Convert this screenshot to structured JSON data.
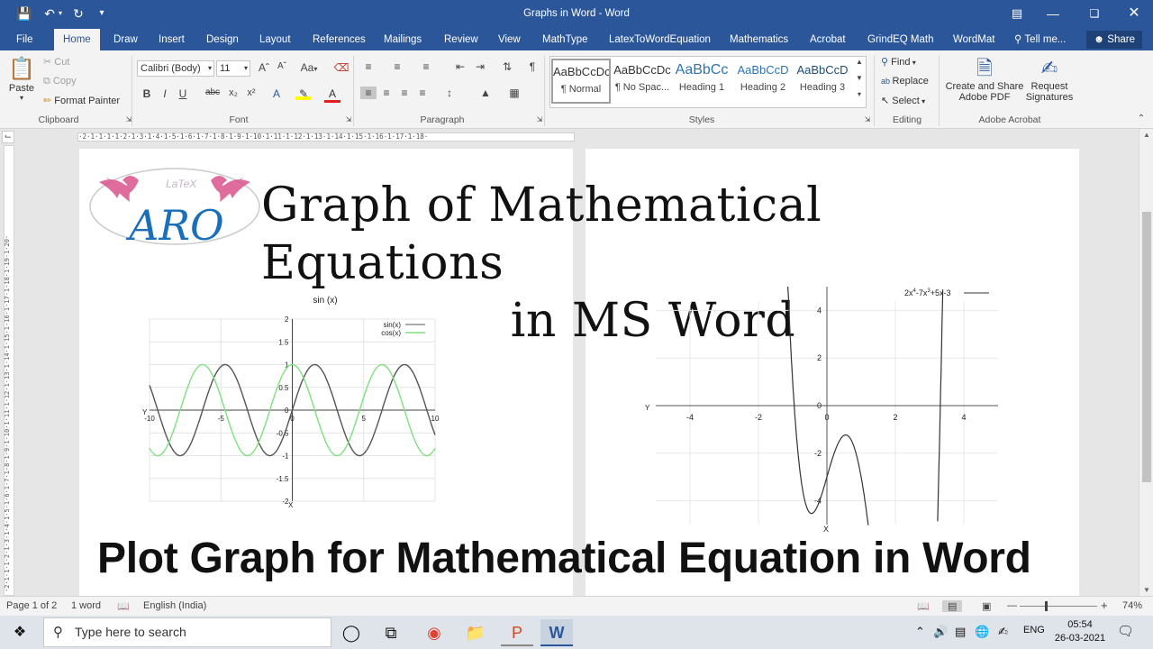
{
  "window": {
    "title": "Graphs in Word - Word",
    "colors": {
      "accent": "#2b579a",
      "ribbon": "#f3f3f3"
    }
  },
  "menu": {
    "file": "File",
    "tabs": [
      "Home",
      "Draw",
      "Insert",
      "Design",
      "Layout",
      "References",
      "Mailings",
      "Review",
      "View",
      "MathType",
      "LatexToWordEquation",
      "Mathematics",
      "Acrobat",
      "GrindEQ Math",
      "WordMat"
    ],
    "tell_me": "Tell me...",
    "share": "Share"
  },
  "ribbon": {
    "clipboard": {
      "paste": "Paste",
      "cut": "Cut",
      "copy": "Copy",
      "format_painter": "Format Painter",
      "label": "Clipboard"
    },
    "font": {
      "name": "Calibri (Body)",
      "size": "11",
      "label": "Font",
      "case": "Aa"
    },
    "paragraph": {
      "label": "Paragraph"
    },
    "styles": {
      "items": [
        {
          "preview": "AaBbCcDc",
          "name": "¶ Normal"
        },
        {
          "preview": "AaBbCcDc",
          "name": "¶ No Spac..."
        },
        {
          "preview": "AaBbCc",
          "name": "Heading 1"
        },
        {
          "preview": "AaBbCcD",
          "name": "Heading 2"
        },
        {
          "preview": "AaBbCcD",
          "name": "Heading 3"
        }
      ],
      "label": "Styles"
    },
    "editing": {
      "find": "Find",
      "replace": "Replace",
      "select": "Select",
      "label": "Editing"
    },
    "acrobat": {
      "create": "Create and Share",
      "create2": "Adobe PDF",
      "request": "Request",
      "request2": "Signatures",
      "label": "Adobe Acrobat"
    }
  },
  "ruler": {
    "marks": "·2·1·1·1·1·2·1·3·1·4·1·5·1·6·1·7·1·8·1·9·1·10·1·11·1·12·1·13·1·14·1·15·1·16·1·17·1·18·"
  },
  "vruler": {
    "marks": "·2·1·1·1·2·1·3·1·4·1·5·1·6·1·7·1·8·1·9·1·10·1·11·1·12·1·13·1·14·1·15·1·16·1·17·1·18·1·19·1·20·"
  },
  "document": {
    "logo_text": "ARO",
    "title_line1": "Graph of Mathematical Equations",
    "title_line2": "in MS Word",
    "caption": "Plot Graph for Mathematical Equation in Word"
  },
  "chart_data": [
    {
      "type": "line",
      "title": "sin (x)",
      "xlabel": "X",
      "ylabel": "Y",
      "xlim": [
        -10,
        10
      ],
      "ylim": [
        -2,
        2
      ],
      "x_ticks": [
        "-10",
        "-5",
        "0",
        "5",
        "10"
      ],
      "y_ticks": [
        "2",
        "1.5",
        "1",
        "0.5",
        "0",
        "-0.5",
        "-1",
        "-1.5",
        "-2"
      ],
      "legend": "top-right",
      "series": [
        {
          "name": "sin(x)",
          "color": "#555555",
          "function": "sin(x)"
        },
        {
          "name": "cos(x)",
          "color": "#7fe07f",
          "function": "cos(x)"
        }
      ]
    },
    {
      "type": "line",
      "title": "",
      "xlabel": "X",
      "ylabel": "Y",
      "xlim": [
        -5,
        5
      ],
      "ylim": [
        -5,
        5
      ],
      "x_ticks": [
        "-4",
        "-2",
        "0",
        "2",
        "4"
      ],
      "y_ticks": [
        "4",
        "2",
        "0",
        "-2",
        "-4"
      ],
      "legend": "top-right",
      "legend_parts": [
        "2x",
        "4",
        "-7x",
        "3",
        "+5x-3"
      ],
      "series": [
        {
          "name": "2x4-7x3+5x-3",
          "color": "#333333",
          "coefficients": [
            2,
            -7,
            0,
            5,
            -3
          ]
        }
      ]
    }
  ],
  "status": {
    "page": "Page 1 of 2",
    "words": "1 word",
    "language": "English (India)",
    "zoom": "74%"
  },
  "taskbar": {
    "search_placeholder": "Type here to search",
    "lang": "ENG",
    "time": "05:54",
    "date": "26-03-2021"
  }
}
